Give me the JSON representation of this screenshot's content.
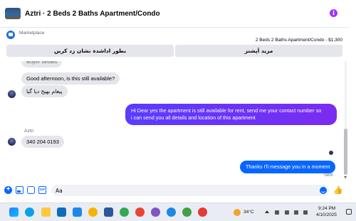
{
  "header": {
    "title": "Aztri · 2 Beds 2 Baths Apartment/Condo",
    "info_icon": "info-icon"
  },
  "listing": {
    "marketplace_label": "Marketplace",
    "subtitle": "2 Beds 2 Baths Apartment/Condo - $1,300",
    "quick_replies": [
      "مزید اَپشنز",
      "بطور اداشدہ نشان زد کریں"
    ]
  },
  "messages": {
    "partial_top": "Buyer details",
    "in_1": "Good afternoon, is this still available?",
    "in_2": "پیغام بھیج دیا گیا",
    "out_1_line1": "Hi Dear yes the apartment  is still available for rent, send me your contact number so",
    "out_1_line2": "i can send you all details and location of this apartment",
    "sender_name": "Aztri",
    "in_3": "340 204 0193",
    "out_2": "Thanks I'll message you in a moment",
    "sent_label": "Sent"
  },
  "composer": {
    "input_value": "Aa",
    "icons": [
      "plus-icon",
      "image-icon",
      "sticker-icon",
      "gif-icon",
      "emoji-icon",
      "like-icon"
    ]
  },
  "taskbar": {
    "weather": "34°C",
    "time": "9:24 PM",
    "date": "4/10/2025"
  },
  "colors": {
    "outgoing_gradient_start": "#3b5bff",
    "outgoing_gradient_end": "#8a2be2",
    "outgoing_blue": "#0866ff",
    "incoming_bg": "#e4e6eb",
    "info_purple": "#a033ff"
  }
}
